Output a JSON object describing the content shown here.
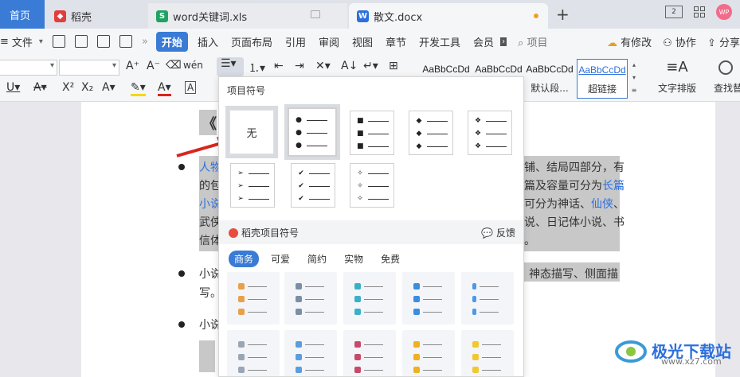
{
  "tabs": {
    "home": "首页",
    "daoke": "稻壳",
    "xls": "word关键词.xls",
    "doc": "散文.docx",
    "plus": "+"
  },
  "window": {
    "two_label": "2",
    "avatar": "WP"
  },
  "menu": {
    "file": "文件",
    "more": "»",
    "items": [
      "开始",
      "插入",
      "页面布局",
      "引用",
      "审阅",
      "视图",
      "章节",
      "开发工具",
      "会员"
    ],
    "search": "项目",
    "right": [
      "有修改",
      "协作",
      "分享"
    ]
  },
  "ribbon": {
    "styles": [
      {
        "preview": "AaBbCcDd",
        "name": ""
      },
      {
        "preview": "AaBbCcDd",
        "name": ""
      },
      {
        "preview": "AaBbCcDd",
        "name": "默认段..."
      },
      {
        "preview": "AaBbCcDd",
        "name": "超链接"
      }
    ],
    "text_layout": "文字排版",
    "find": "查找替"
  },
  "doc": {
    "title_char": "《",
    "lines": [
      {
        "pre": "人物",
        "post": "铺、结局四部分，有"
      },
      {
        "pre": "的包",
        "post": "篇及容量可分为",
        "link": "长篇"
      },
      {
        "pre": "小说",
        "post": "可分为神话、",
        "link2": "仙侠",
        "tail": "、"
      },
      {
        "pre": "武侠",
        "post": "说、日记体小说、书"
      },
      {
        "pre": "信体",
        "post": "。"
      }
    ],
    "line6": {
      "pre": "小说",
      "post": "神态描写、侧面描"
    },
    "line7": "写。",
    "line8": "小说"
  },
  "panel": {
    "title": "项目符号",
    "none_label": "无",
    "section2": "稻壳项目符号",
    "feedback": "反馈",
    "categories": [
      "商务",
      "可爱",
      "简约",
      "实物",
      "免费"
    ]
  },
  "watermark": {
    "brand": "极光下载站",
    "url": "www.xz7.com"
  },
  "colors": {
    "accent": "#3a7bd5",
    "link": "#2d6fdc",
    "arrow": "#d9261c"
  }
}
